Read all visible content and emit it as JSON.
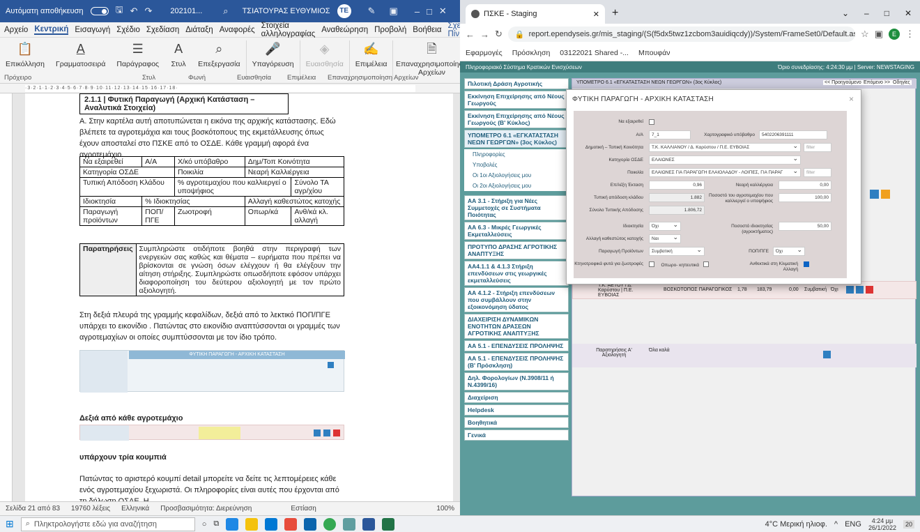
{
  "word": {
    "autosave": "Αυτόματη αποθήκευση",
    "filename": "202101...",
    "user": "ΤΣΙΑΤΟΥΡΑΣ ΕΥΘΥΜΙΟΣ",
    "menu": [
      "Αρχείο",
      "Κεντρική",
      "Εισαγωγή",
      "Σχέδιο",
      "Σχεδίαση",
      "Διάταξη",
      "Αναφορές",
      "Στοιχεία αλληλογραφίας",
      "Αναθεώρηση",
      "Προβολή",
      "Βοήθεια",
      "Σχεδίαση Πίν"
    ],
    "ribbon": {
      "paste": "Επικόλληση",
      "font": "Γραμματοσειρά",
      "paragraph": "Παράγραφος",
      "styles": "Στυλ",
      "editing": "Επεξεργασία",
      "dictate": "Υπαγόρευση",
      "sensitivity": "Ευαισθησία",
      "editor": "Επιμέλεια",
      "reuse": "Επαναχρησιμοποίηση Αρχείων"
    },
    "groups": {
      "clipboard": "Πρόχειρο",
      "styles": "Στυλ",
      "voice": "Φωνή",
      "sensitivity": "Ευαισθησία",
      "editor": "Επιμέλεια",
      "reuse": "Επαναχρησιμοποίηση Αρχείων"
    },
    "doc": {
      "heading": "2.1.1 | Φυτική Παραγωγή (Αρχική Κατάσταση – Αναλυτικά Στοιχεία)",
      "para1": "Α. Στην καρτέλα αυτή αποτυπώνεται η εικόνα της αρχικής κατάστασης. Εδώ βλέπετε τα αγροτεμάχια και τους βοσκότοπους της εκμετάλλευσης όπως έχουν αποσταλεί στο ΠΣΚΕ από το ΟΣΔΕ. Κάθε γραμμή αφορά ένα αγροτεμάχιο.",
      "t1": {
        "r1": [
          "Να εξαιρεθεί",
          "Α/Α",
          "Χ/κό υπόβαθρο",
          "Δημ/Τοπ Κοινότητα"
        ],
        "r2": [
          "Κατηγορία ΟΣΔΕ",
          "Ποικιλία",
          "Νεαρή Καλλιέργεια"
        ],
        "r3": [
          "Τυπική Απόδοση Κλάδου",
          "% αγροτεμαχίου που καλλιεργεί ο υποψήφιος",
          "Σύνολο ΤΑ αγρ/χίου"
        ],
        "r4": [
          "Ιδιοκτησία",
          "% Ιδιοκτησίας",
          "Αλλαγή καθεστώτος κατοχής"
        ],
        "r5": [
          "Παραγωγή προϊόντων",
          "ΠΟΠ/ΠΓΕ",
          "Ζωοτροφή",
          "Οπωρ/κά",
          "Ανθ/κά κλ. αλλαγή"
        ]
      },
      "notes_label": "Παρατηρήσεις",
      "notes": "Συμπληρώστε οτιδήποτε βοηθά στην περιγραφή των ενεργειών σας καθώς και θέματα – ευρήματα που πρέπει να βρίσκονται σε γνώση όσων ελέγχουν ή θα ελέγξουν την αίτηση στήριξης. Συμπληρώστε οπωσδήποτε εφόσον υπάρχει διαφοροποίηση του δεύτερου αξιολογητή με τον πρώτο αξιολογητή.",
      "para2": "Στη δεξιά πλευρά της γραμμής κεφαλίδων, δεξιά από το λεκτικό ΠΟΠ/ΠΓΕ υπάρχει το εικονίδιο . Πατώντας στο εικονίδιο αναπτύσσονται οι γραμμές των αγροτεμαχίων οι οποίες συμπτύσσονται με τον ίδιο τρόπο.",
      "thumb_title": "ΦΥΤΙΚΗ ΠΑΡΑΓΩΓΗ - ΑΡΧΙΚΗ ΚΑΤΑΣΤΑΣΗ",
      "para3": "Δεξιά από κάθε αγροτεμάχιο",
      "para4": "υπάρχουν τρία κουμπιά",
      "para5": "Πατώντας το αριστερό κουμπί detail  μπορείτε να δείτε τις λεπτομέρειες κάθε ενός αγροτεμαχίου ξεχωριστά. Οι πληροφορίες είναι αυτές που έρχονται από τη δήλωση ΟΣΔΕ. Η"
    },
    "status": {
      "page": "Σελίδα 21 από 83",
      "words": "19760 λέξεις",
      "lang": "Ελληνικά",
      "access": "Προσβασιμότητα: Διερεύνηση",
      "focus": "Εστίαση",
      "zoom": "100%"
    }
  },
  "chrome": {
    "tab_title": "ΠΣΚΕ - Staging",
    "url": "report.ependyseis.gr/mis_staging/(S(f5dx5twz1zcbom3auidiqcdy))/System/FrameSet0/Default.as...",
    "bookmarks": [
      "Εφαρμογές",
      "Πρόσκληση",
      "03122021 Shared -...",
      "Μπουφάν"
    ]
  },
  "site": {
    "top_left": "Πληροφοριακό Σύστημα Κρατικών Ενισχύσεων",
    "top_right": "Όριο συνεδρίασης: 4:24:30 μμ | Server: NEWSTAGING",
    "breadcrumb": "ΥΠΟΜΕΤΡΟ 6.1 «ΕΓΚΑΤΑΣΤΑΣΗ ΝΕΩΝ ΓΕΩΡΓΩΝ» (3ος Κύκλος)",
    "nav_prev": "<< Προηγούμενο",
    "nav_next": "Επόμενο >>",
    "guide": "Οδηγίες",
    "sidebar": [
      "Πιλοτική Δράση Αγροτικής",
      "Εκκίνηση Επιχείρησης από Νέους Γεωργούς",
      "Εκκίνηση Επιχείρησης από Νέους Γεωργούς (Β' Κύκλος)",
      "ΥΠΟΜΕΤΡΟ 6.1 «ΕΓΚΑΤΑΣΤΑΣΗ ΝΕΩΝ ΓΕΩΡΓΩΝ» (3ος Κύκλος)",
      "ΑΑ 3.1 - Στήριξη για Νέες Συμμετοχές σε Συστήματα Ποιότητας",
      "ΑΑ 6.3 - Μικρές Γεωργικές Εκμεταλλεύσεις",
      "ΠΡΟΤΥΠΟ ΔΡΑΣΗΣ ΑΓΡΟΤΙΚΗΣ ΑΝΑΠΤΥΞΗΣ",
      "ΑΑ4.1.1 & 4.1.3 Στήριξη επενδύσεων στις γεωργικές εκμεταλλεύσεις",
      "ΑΑ 4.1.2 - Στήριξη επενδύσεων που συμβάλλουν στην εξοικονόμηση ύδατος",
      "ΔΙΑΧΕΙΡΙΣΗ ΔΥΝΑΜΙΚΩΝ ΕΝΟΤΗΤΩΝ ΔΡΑΣΕΩΝ ΑΓΡΟΤΙΚΗΣ ΑΝΑΠΤΥΞΗΣ",
      "ΑΑ 5.1 - ΕΠΕΝΔΥΣΕΙΣ ΠΡΟΛΗΨΗΣ",
      "ΑΑ 5.1 - ΕΠΕΝΔΥΣΕΙΣ ΠΡΟΛΗΨΗΣ (Β' Πρόσκληση)",
      "Δηλ. Φορολογίων (Ν.3908/11 ή Ν.4399/16)",
      "Διαχείριση",
      "Helpdesk",
      "Βοηθητικά",
      "Γενικά"
    ],
    "sub_items": [
      "Πληροφορίες",
      "Υποβολές",
      "Οι 1οι Αξιολογήσεις μου",
      "Οι 2οι Αξιολογήσεις μου"
    ],
    "bg_row": {
      "place": "Τ.Κ. ΑΕΤΟΥ / Δ. Καρύστου | Π.Ε. ΕΥΒΟΙΑΣ",
      "type": "ΒΟΣΚΟΤΟΠΟΣ ΠΑΡΑΓΩΓΙΚΟΣ",
      "a": "1,78",
      "b": "183,79",
      "c": "0,00",
      "d": "Συμβατική",
      "e": "Όχι"
    },
    "remarks_label": "Παρατηρήσεις Α' Αξιολογητή",
    "remarks_value": "Όλα καλά"
  },
  "modal": {
    "title": "ΦΥΤΙΚΗ ΠΑΡΑΓΩΓΗ - ΑΡΧΙΚΗ ΚΑΤΑΣΤΑΣΗ",
    "labels": {
      "exclude": "Να εξαιρεθεί",
      "aa": "Α/Α",
      "map": "Χαρτογραφικό υπόβαθρο",
      "community": "Δημοτική – Τοπική Κοινότητα",
      "category": "Κατηγορία ΟΣΔΕ",
      "variety": "Ποικιλία",
      "area": "Επ/λέξη Έκταση",
      "young": "Νεαρή καλλιέργεια",
      "yield": "Τυπική απόδοση κλάδου",
      "pct": "Ποσοστό του αγροτεμαχίου που καλλιεργεί ο υποψήφιος",
      "total": "Σύνολο Τυπικής Απόδοσης",
      "ownership": "Ιδιοκτησία",
      "own_pct": "Ποσοστό ιδιοκτησίας (αγροκτήματος)",
      "change": "Αλλαγή καθεστώτος κατοχής",
      "production": "Παραγωγή Προϊόντων",
      "pop": "ΠΟΠ/ΠΓΕ",
      "forage": "Κτηνοτροφικά φυτά για ζωοτροφές",
      "orchard": "Οπωρο- κηπευτικά",
      "climate": "Ανθεκτικά στη Κλιματική Αλλαγή"
    },
    "values": {
      "aa": "7_1",
      "map": "5402206391111",
      "community": "Τ.Κ. ΚΑΛΛΙΑΝΟΥ / Δ. Καρύστου / Π.Ε. ΕΥΒΟΙΑΣ",
      "filter": "filter",
      "category": "ΕΛΑΙΩΝΕΣ",
      "variety": "ΕΛΑΙΩΝΕΣ ΓΙΑ ΠΑΡΑΓΩΓΗ ΕΛΑΙΟΛΑΔΟΥ - ΛΟΙΠΕΣ, ΓΙΑ ΠΑΡΑΓ",
      "area": "0,96",
      "young": "0,00",
      "yield": "1.882",
      "pct": "100,00",
      "total": "1.806,72",
      "ownership": "Όχι",
      "own_pct": "50,00",
      "change": "Ναι",
      "production": "Συμβατική",
      "pop": "Όχι"
    }
  },
  "taskbar": {
    "search": "Πληκτρολογήστε εδώ για αναζήτηση",
    "weather": "4°C Μερική ηλιοφ.",
    "lang": "ENG",
    "time": "4:24 μμ",
    "date": "26/1/2022",
    "notif": "20"
  }
}
